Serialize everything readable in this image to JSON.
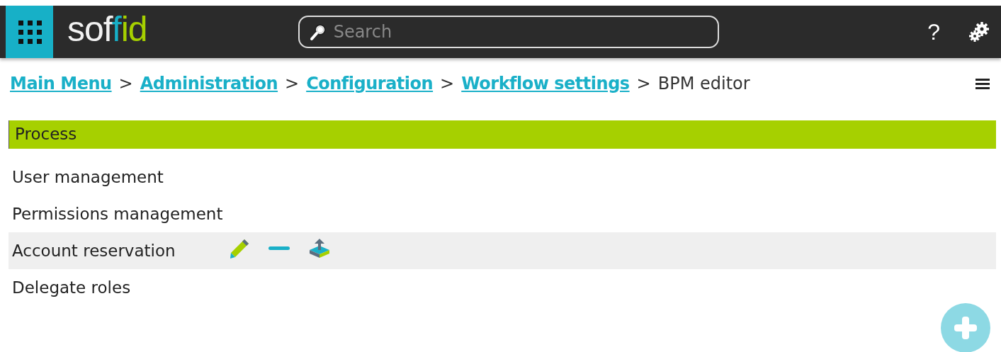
{
  "header": {
    "logo": "soffid",
    "search": {
      "placeholder": "Search"
    },
    "help": "?"
  },
  "breadcrumb_separator": ">",
  "breadcrumb": [
    {
      "label": "Main Menu",
      "kind": "link"
    },
    {
      "label": "Administration",
      "kind": "link"
    },
    {
      "label": "Configuration",
      "kind": "link"
    },
    {
      "label": "Workflow settings",
      "kind": "link"
    },
    {
      "label": "BPM editor",
      "kind": "current"
    }
  ],
  "table": {
    "column": "Process",
    "rows": [
      {
        "name": "User management",
        "selected": false
      },
      {
        "name": "Permissions management",
        "selected": false
      },
      {
        "name": "Account reservation",
        "selected": true
      },
      {
        "name": "Delegate roles",
        "selected": false
      }
    ]
  }
}
